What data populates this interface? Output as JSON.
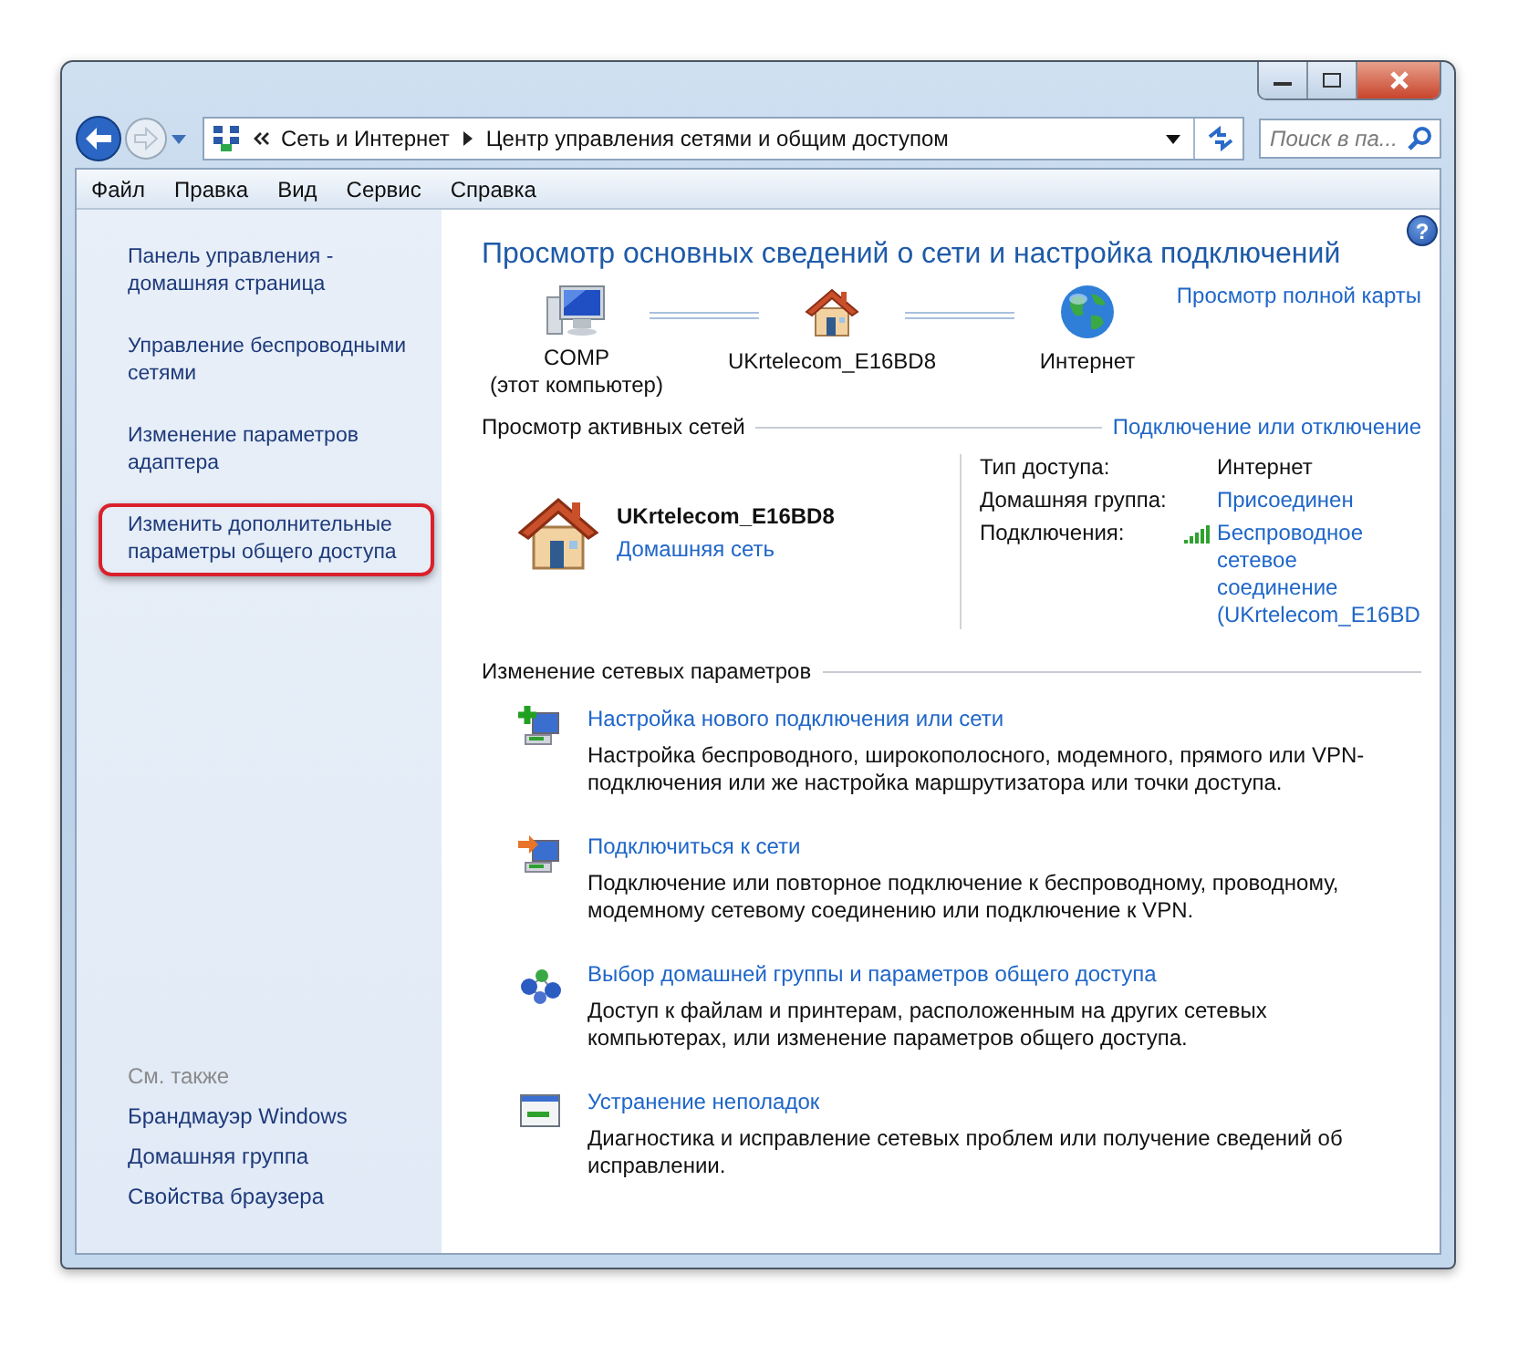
{
  "window": {
    "breadcrumb": [
      "Сеть и Интернет",
      "Центр управления сетями и общим доступом"
    ],
    "search": {
      "placeholder": "Поиск в па..."
    }
  },
  "menu": [
    "Файл",
    "Правка",
    "Вид",
    "Сервис",
    "Справка"
  ],
  "sidebar": {
    "items": [
      {
        "label": "Панель управления - домашняя страница",
        "highlighted": false
      },
      {
        "label": "Управление беспроводными сетями",
        "highlighted": false
      },
      {
        "label": "Изменение параметров адаптера",
        "highlighted": false
      },
      {
        "label": "Изменить дополнительные параметры общего доступа",
        "highlighted": true
      }
    ],
    "see_also": {
      "heading": "См. также",
      "items": [
        "Брандмауэр Windows",
        "Домашняя группа",
        "Свойства браузера"
      ]
    }
  },
  "main": {
    "help": "?",
    "title": "Просмотр основных сведений о сети и настройка подключений",
    "network_map": {
      "nodes": [
        {
          "name": "COMP",
          "note": "(этот компьютер)"
        },
        {
          "name": "UKrtelecom_E16BD8"
        },
        {
          "name": "Интернет"
        }
      ],
      "full_map_link": "Просмотр полной карты"
    },
    "active_networks": {
      "heading": "Просмотр активных сетей",
      "link": "Подключение или отключение",
      "network": {
        "name": "UKrtelecom_E16BD8",
        "type": "Домашняя сеть"
      },
      "details": [
        {
          "label": "Тип доступа:",
          "value": "Интернет",
          "kind": "text"
        },
        {
          "label": "Домашняя группа:",
          "value": "Присоединен",
          "kind": "link"
        },
        {
          "label": "Подключения:",
          "value": "Беспроводное сетевое соединение (UKrtelecom_E16BD",
          "kind": "wireless"
        }
      ]
    },
    "settings": {
      "heading": "Изменение сетевых параметров",
      "tasks": [
        {
          "title": "Настройка нового подключения или сети",
          "description": "Настройка беспроводного, широкополосного, модемного, прямого или VPN-подключения или же настройка маршрутизатора или точки доступа."
        },
        {
          "title": "Подключиться к сети",
          "description": "Подключение или повторное подключение к беспроводному, проводному, модемному сетевому соединению или подключение к VPN."
        },
        {
          "title": "Выбор домашней группы и параметров общего доступа",
          "description": "Доступ к файлам и принтерам, расположенным на других сетевых компьютерах, или изменение параметров общего доступа."
        },
        {
          "title": "Устранение неполадок",
          "description": "Диагностика и исправление сетевых проблем или получение сведений об исправлении."
        }
      ]
    }
  }
}
